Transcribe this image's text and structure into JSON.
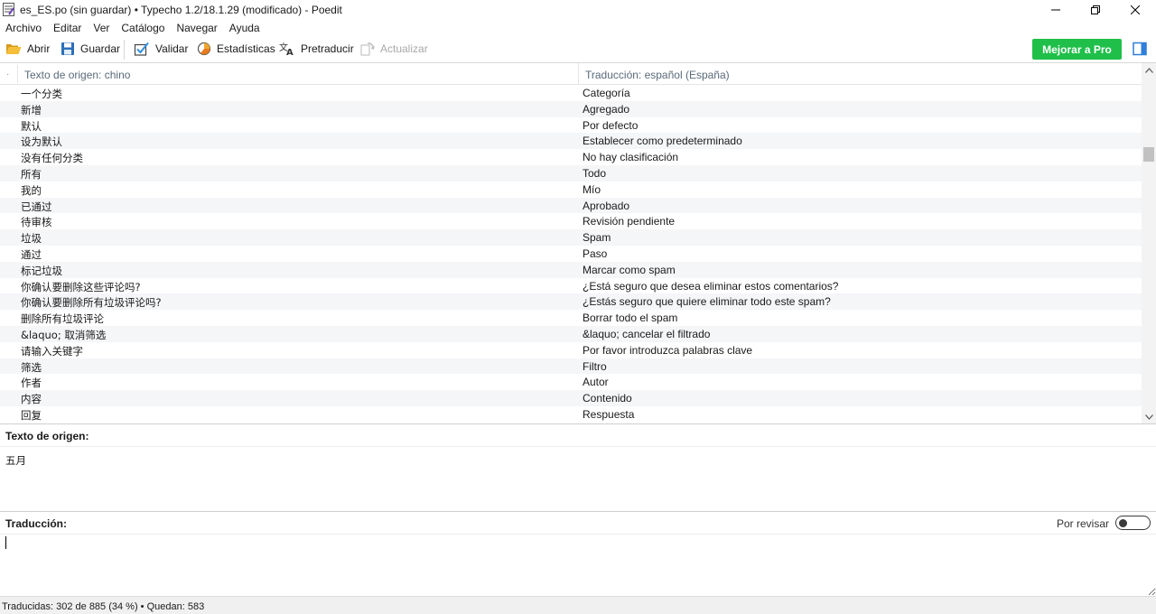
{
  "window": {
    "title": "es_ES.po (sin guardar) • Typecho 1.2/18.1.29 (modificado) - Poedit",
    "app_icon": "poedit-icon"
  },
  "menu": [
    "Archivo",
    "Editar",
    "Ver",
    "Catálogo",
    "Navegar",
    "Ayuda"
  ],
  "toolbar": {
    "open": "Abrir",
    "save": "Guardar",
    "validate": "Validar",
    "stats": "Estadísticas",
    "pretranslate": "Pretraducir",
    "update": "Actualizar",
    "pro": "Mejorar a Pro",
    "accent_color": "#1fbf4a"
  },
  "list": {
    "header_source": "Texto de origen: chino",
    "header_translation": "Traducción: español (España)",
    "rows": [
      {
        "src": "一个分类",
        "trans": "Categoría"
      },
      {
        "src": "新增",
        "trans": "Agregado"
      },
      {
        "src": "默认",
        "trans": "Por defecto"
      },
      {
        "src": "设为默认",
        "trans": "Establecer como predeterminado"
      },
      {
        "src": "没有任何分类",
        "trans": "No hay clasificación"
      },
      {
        "src": "所有",
        "trans": "Todo"
      },
      {
        "src": "我的",
        "trans": "Mío"
      },
      {
        "src": "已通过",
        "trans": "Aprobado"
      },
      {
        "src": "待审核",
        "trans": "Revisión pendiente"
      },
      {
        "src": "垃圾",
        "trans": "Spam"
      },
      {
        "src": "通过",
        "trans": "Paso"
      },
      {
        "src": "标记垃圾",
        "trans": "Marcar como spam"
      },
      {
        "src": "你确认要删除这些评论吗?",
        "trans": "¿Está seguro que desea eliminar estos comentarios?"
      },
      {
        "src": "你确认要删除所有垃圾评论吗?",
        "trans": "¿Estás seguro que quiere eliminar todo este spam?"
      },
      {
        "src": "删除所有垃圾评论",
        "trans": "Borrar todo el spam"
      },
      {
        "src": "&laquo; 取消筛选",
        "trans": "&laquo; cancelar el filtrado"
      },
      {
        "src": "请输入关键字",
        "trans": "Por favor introduzca palabras clave"
      },
      {
        "src": "筛选",
        "trans": "Filtro"
      },
      {
        "src": "作者",
        "trans": "Autor"
      },
      {
        "src": "内容",
        "trans": "Contenido"
      },
      {
        "src": "回复",
        "trans": "Respuesta"
      }
    ]
  },
  "source_panel": {
    "label": "Texto de origen:",
    "text": "五月"
  },
  "translation_panel": {
    "label": "Traducción:",
    "needs_review_label": "Por revisar",
    "value": ""
  },
  "status": {
    "text": "Traducidas: 302 de 885 (34 %)  •  Quedan: 583"
  }
}
